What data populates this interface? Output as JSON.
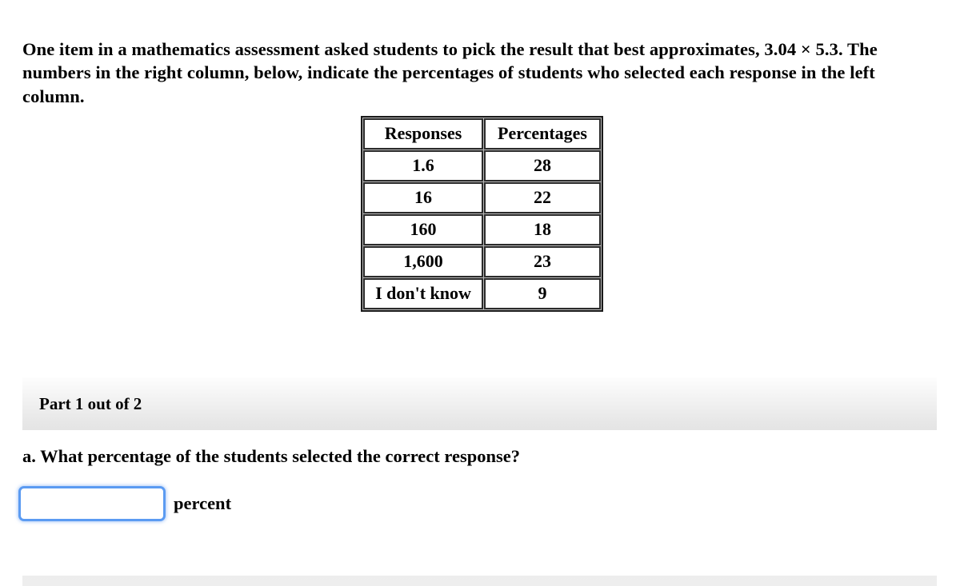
{
  "prompt": {
    "text": "One item in a mathematics assessment asked students to pick the result that best approximates, 3.04 × 5.3. The numbers in the right column, below, indicate the percentages of students who selected each response in the left column."
  },
  "table": {
    "headers": [
      "Responses",
      "Percentages"
    ],
    "rows": [
      {
        "response": "1.6",
        "percentage": "28"
      },
      {
        "response": "16",
        "percentage": "22"
      },
      {
        "response": "160",
        "percentage": "18"
      },
      {
        "response": "1,600",
        "percentage": "23"
      },
      {
        "response": "I don't know",
        "percentage": "9"
      }
    ]
  },
  "part_banner": {
    "label": "Part 1 out of 2"
  },
  "question": {
    "label": "a. What percentage of the students selected the correct response?"
  },
  "answer": {
    "value": "",
    "placeholder": "",
    "unit_label": "percent"
  },
  "colors": {
    "focus_blue": "#5b9bf2",
    "banner_gray": "#eaeaea",
    "table_border": "#2b2b2b"
  }
}
